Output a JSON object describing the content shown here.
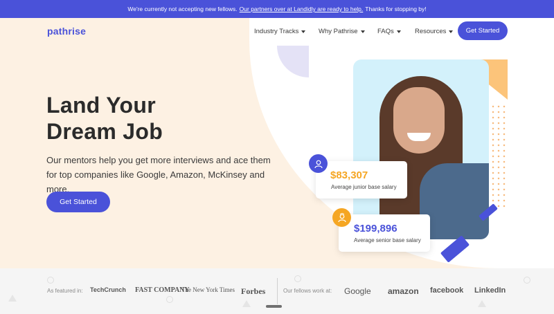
{
  "banner": {
    "text_before": "We're currently not accepting new fellows.",
    "link_text": "Our partners over at Landidly are ready to help.",
    "text_after": "Thanks for stopping by!"
  },
  "nav": {
    "logo": "pathrise",
    "items": [
      {
        "label": "Industry Tracks"
      },
      {
        "label": "Why Pathrise"
      },
      {
        "label": "FAQs"
      },
      {
        "label": "Resources"
      }
    ],
    "cta": "Get Started"
  },
  "hero": {
    "headline_line1": "Land Your",
    "headline_line2": "Dream Job",
    "subcopy": "Our mentors help you get more interviews and ace them for top companies like Google, Amazon, McKinsey and more.",
    "cta": "Get Started"
  },
  "stats": [
    {
      "amount": "$83,307",
      "label": "Average junior base salary",
      "color": "#f5a623"
    },
    {
      "amount": "$199,896",
      "label": "Average senior base salary",
      "color": "#4a52d9"
    }
  ],
  "press": {
    "featured_label": "As featured in:",
    "featured_logos": [
      "TechCrunch",
      "FAST COMPANY",
      "The New York Times",
      "Forbes"
    ],
    "fellows_label": "Our fellows work at:",
    "company_logos": [
      "Google",
      "amazon",
      "facebook",
      "LinkedIn"
    ]
  },
  "colors": {
    "brand": "#4a52d9",
    "accent": "#f5a623",
    "hero_bg": "#fdf1e3"
  }
}
